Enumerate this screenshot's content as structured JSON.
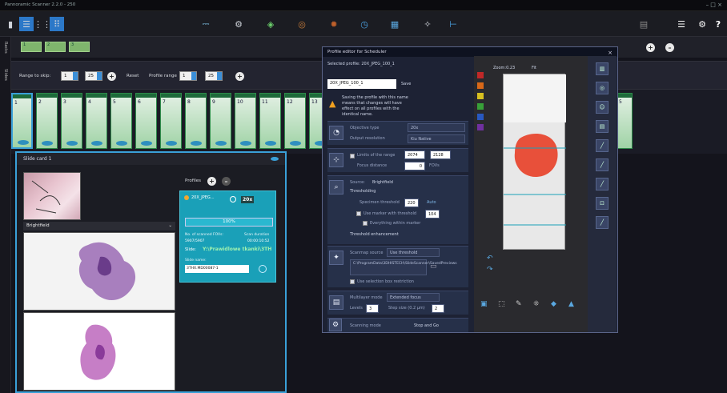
{
  "app": {
    "title": "Pannoramic Scanner 2.2.0 - 250",
    "window_controls": "– □ ×"
  },
  "toolbar": {
    "icons": [
      "layout-icon",
      "grid-icon",
      "grid-dense-icon",
      "scanner-icon",
      "scan-settings-icon",
      "diamond-icon",
      "coin-icon",
      "flame-icon",
      "clock-icon",
      "camera-icon",
      "wrench-icon",
      "plug-icon",
      "slide-icon",
      "stack-icon",
      "gear-icon",
      "help-icon"
    ],
    "help": "?"
  },
  "tray": {
    "racks": [
      "1",
      "2",
      "3"
    ],
    "racks_label": "Racks",
    "slides_label": "Slides"
  },
  "range": {
    "skip_label": "Range to skip:",
    "skip_from": "1",
    "skip_to": "25",
    "reset_label": "Reset",
    "profile_label": "Profile range",
    "profile_from": "1",
    "profile_to": "25",
    "plus": "+",
    "right_buttons": [
      "+",
      "–"
    ]
  },
  "slots": [
    "1",
    "2",
    "3",
    "4",
    "5",
    "6",
    "7",
    "8",
    "9",
    "10",
    "11",
    "12",
    "13"
  ],
  "slot_right": "5",
  "slidecard": {
    "title": "Slide card 1",
    "bf_label": "Brightfield",
    "profiles_label": "Profiles",
    "profile": {
      "name": "20X_JPEG...",
      "mag": "20x",
      "percent": "100%",
      "fov_label": "No. of scanned FOVs:",
      "fov_value": "5907/5907",
      "dur_label": "Scan duration",
      "dur_value": "00:00:10:52",
      "slide_label": "Slide:",
      "slide_path": "Y:\\Prawidlowe tkanki\\3TH",
      "name_label": "Slide name:",
      "name_value": "3THX.MD00087-1"
    }
  },
  "dialog": {
    "title": "Profile editor for Scheduler",
    "close": "×",
    "selected_label": "Selected profile: 20X_JPEG_100_1",
    "name_value": "20X_JPEG_100_1",
    "save_label": "Save",
    "warning": "Saving the profile with this name means that changes will have effect on all profiles with the identical name.",
    "objective_label": "Objective type",
    "objective_value": "20x",
    "output_label": "Output resolution",
    "output_value": "Kiu Native",
    "limits_label": "Limits of the range",
    "limit1": "2074",
    "limit2": "2128",
    "focus_label": "Focus distance",
    "focus_value": "0",
    "focus_unit": "FOVs",
    "source_label": "Source:",
    "source_value": "Brightfield",
    "threshold_label": "Thresholding",
    "spec_label": "Specimen threshold",
    "spec_value": "220",
    "auto_label": "Auto",
    "marker_label": "Use marker with threshold",
    "marker_value": "104",
    "everything_label": "Everything within marker",
    "enh_label": "Threshold enhancement",
    "scanmap_label": "Scanmap source",
    "scanmap_value": "Use threshold",
    "path_value": "C:\\ProgramData\\3DHISTECH\\SlideScanner\\SavedPreviews",
    "selbox_label": "Use selection box restriction",
    "multilayer_label": "Multilayer mode",
    "multilayer_value": "Extended focus",
    "levels_label": "Levels",
    "levels_value": "3",
    "step_label": "Step size (0.2 µm)",
    "step_value": "2",
    "scanning_label": "Scanning mode",
    "scanning_value": "Stop and Go",
    "zoom": "Zoom:0.23",
    "fit": "Fit"
  },
  "colors": {
    "accent": "#3aa0d8",
    "slot_green": "#9fd3a6",
    "tissue_red": "#e8503a",
    "profile_teal": "#1aa0b8"
  }
}
